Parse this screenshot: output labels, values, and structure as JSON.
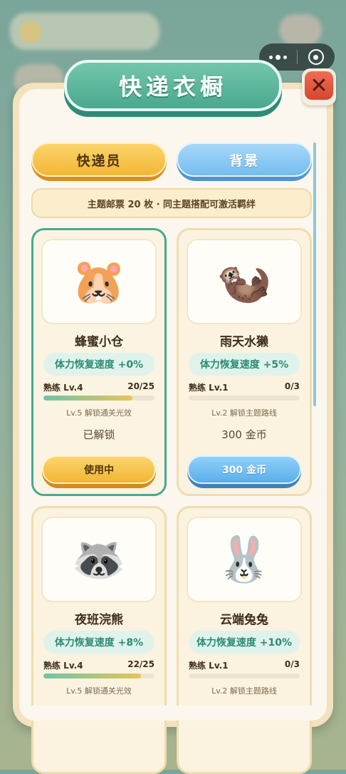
{
  "modal": {
    "title": "快递衣橱",
    "close_icon": "close-x-icon"
  },
  "capsule": {
    "more_icon": "more-dots-icon",
    "exit_icon": "target-circle-icon"
  },
  "tabs": [
    {
      "label": "快递员",
      "active": true
    },
    {
      "label": "背景",
      "active": false
    }
  ],
  "banner": {
    "text": "主题邮票 20 枚 · 同主题搭配可激活羁绊"
  },
  "cards": [
    {
      "name": "蜂蜜小仓",
      "portrait_icon": "hamster-courier-icon",
      "portrait_glyph": "🐹",
      "buff": "体力恢复速度 +0%",
      "skill_label": "熟练 Lv.4",
      "progress_text": "20/25",
      "progress": 0.8,
      "hint": "Lv.5 解锁通关光效",
      "status": "已解锁",
      "button": "使用中",
      "button_style": "gold",
      "selected": true
    },
    {
      "name": "雨天水獭",
      "portrait_icon": "otter-courier-icon",
      "portrait_glyph": "🦦",
      "buff": "体力恢复速度 +5%",
      "skill_label": "熟练 Lv.1",
      "progress_text": "0/3",
      "progress": 0,
      "hint": "Lv.2 解锁主题路线",
      "status": "300 金币",
      "button": "300 金币",
      "button_style": "blue",
      "selected": false
    },
    {
      "name": "夜班浣熊",
      "portrait_icon": "raccoon-scooter-icon",
      "portrait_glyph": "🦝",
      "buff": "体力恢复速度 +8%",
      "skill_label": "熟练 Lv.4",
      "progress_text": "22/25",
      "progress": 0.88,
      "hint": "Lv.5 解锁通关光效",
      "selected": false
    },
    {
      "name": "云端兔兔",
      "portrait_icon": "bunny-pilot-icon",
      "portrait_glyph": "🐰",
      "buff": "体力恢复速度 +10%",
      "skill_label": "熟练 Lv.1",
      "progress_text": "0/3",
      "progress": 0,
      "hint": "Lv.2 解锁主题路线",
      "selected": false
    }
  ]
}
